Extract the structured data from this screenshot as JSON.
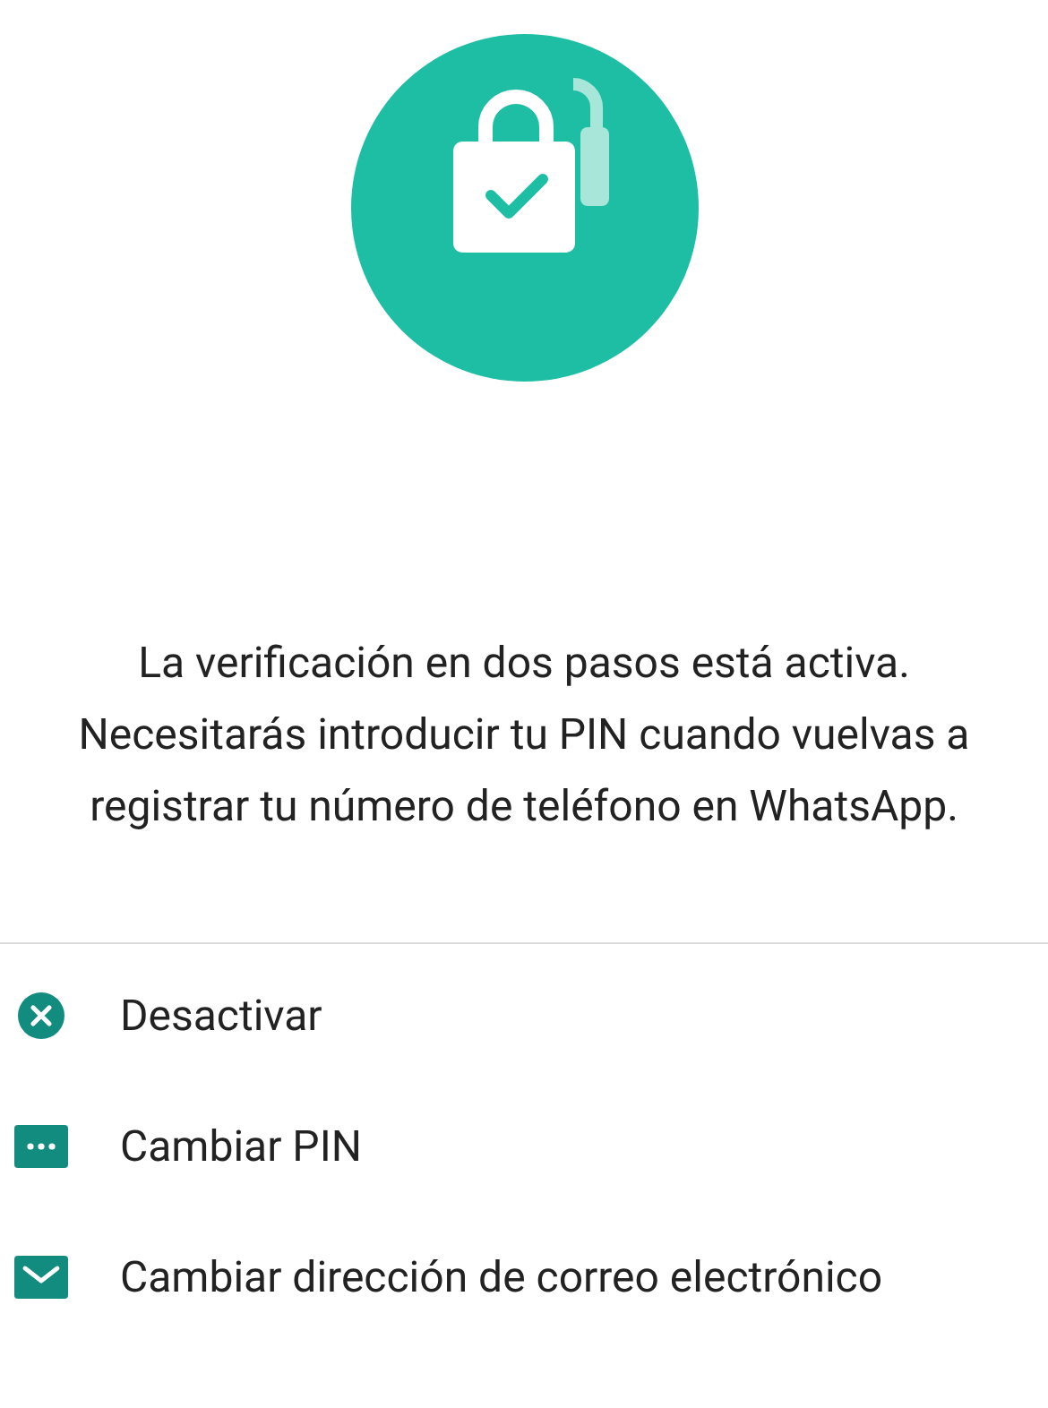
{
  "message": "La verificación en dos pasos está activa. Necesitarás introducir tu PIN cuando vuelvas a registrar tu número de teléfono en WhatsApp.",
  "actions": [
    {
      "kind": "disable",
      "label": "Desactivar"
    },
    {
      "kind": "pin",
      "label": "Cambiar PIN"
    },
    {
      "kind": "email",
      "label": "Cambiar dirección de correo electrónico"
    }
  ]
}
